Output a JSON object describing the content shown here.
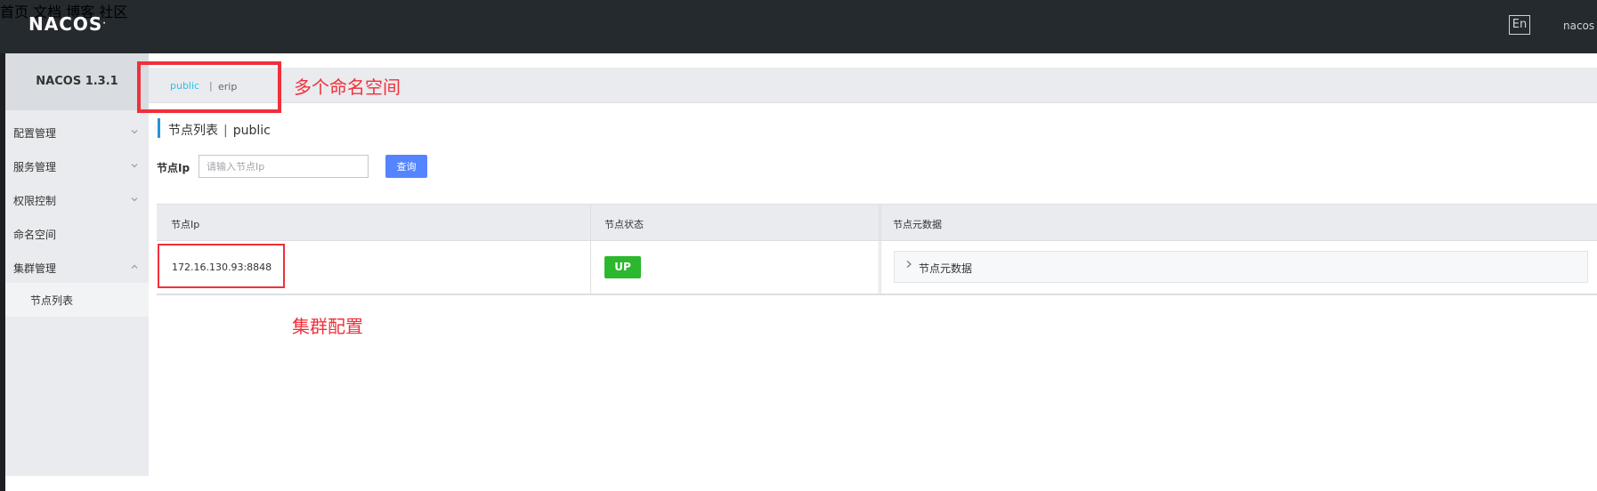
{
  "header": {
    "logo": "NACOS",
    "logo_mark": ".",
    "nav": [
      "首页",
      "文档",
      "博客",
      "社区"
    ],
    "lang": "En",
    "user": "nacos"
  },
  "sidebar": {
    "title": "NACOS 1.3.1",
    "items": [
      {
        "label": "配置管理",
        "icon": "chevron-down-icon"
      },
      {
        "label": "服务管理",
        "icon": "chevron-down-icon"
      },
      {
        "label": "权限控制",
        "icon": "chevron-down-icon"
      },
      {
        "label": "命名空间",
        "icon": ""
      },
      {
        "label": "集群管理",
        "icon": "chevron-up-icon"
      }
    ],
    "sub_item": "节点列表"
  },
  "namespace": {
    "tabs": [
      "public",
      "erip"
    ],
    "separator": "|",
    "active": "public",
    "active_color": "#33bde5"
  },
  "annotations": {
    "namespace_note": "多个命名空间",
    "cluster_note": "集群配置",
    "color": "#f0303a"
  },
  "page": {
    "title": "节点列表",
    "divider": "|",
    "namespace": "public"
  },
  "search": {
    "label": "节点Ip",
    "placeholder": "请输入节点Ip",
    "value": "",
    "button": "查询"
  },
  "table": {
    "columns": [
      "节点Ip",
      "节点状态",
      "节点元数据"
    ],
    "rows": [
      {
        "ip": "172.16.130.93:8848",
        "status": "UP",
        "metadata_label": "节点元数据"
      }
    ],
    "status_color": "#2cb82e"
  }
}
